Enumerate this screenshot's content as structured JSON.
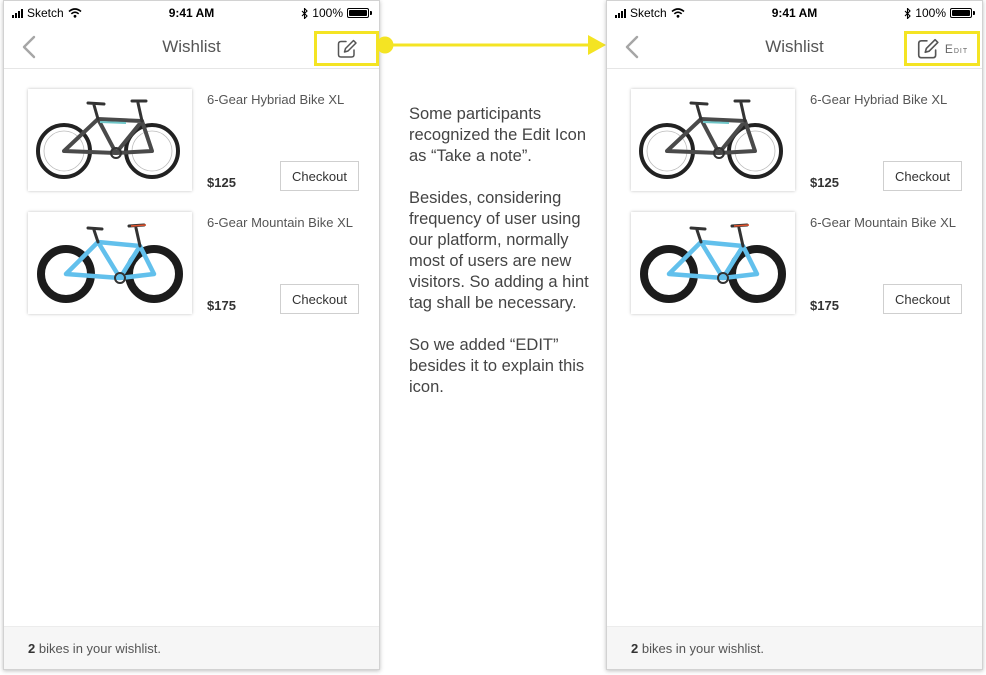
{
  "status_bar": {
    "carrier": "Sketch",
    "time": "9:41 AM",
    "battery": "100%"
  },
  "nav": {
    "title": "Wishlist",
    "edit_label": "Edit"
  },
  "items": [
    {
      "name": "6-Gear Hybriad Bike XL",
      "price": "$125",
      "checkout_label": "Checkout",
      "frame_color": "#4a4a4a",
      "accent_color": "#6fc6c8"
    },
    {
      "name": "6-Gear Mountain Bike XL",
      "price": "$175",
      "checkout_label": "Checkout",
      "frame_color": "#62c0ec",
      "accent_color": "#e3552f"
    }
  ],
  "footer": {
    "count": "2",
    "text": " bikes in your wishlist."
  },
  "annotation": {
    "paragraphs": [
      "Some participants recognized the Edit Icon as “Take a note”.",
      "Besides, considering frequency of user using our platform, normally most of users are new visitors. So adding a hint tag shall be necessary.",
      "So we added “EDIT” besides it to explain this icon."
    ]
  },
  "colors": {
    "highlight": "#f4e423"
  },
  "icons": [
    "back-chevron-icon",
    "edit-pencil-icon",
    "wifi-icon",
    "bluetooth-icon",
    "battery-icon",
    "signal-icon"
  ]
}
